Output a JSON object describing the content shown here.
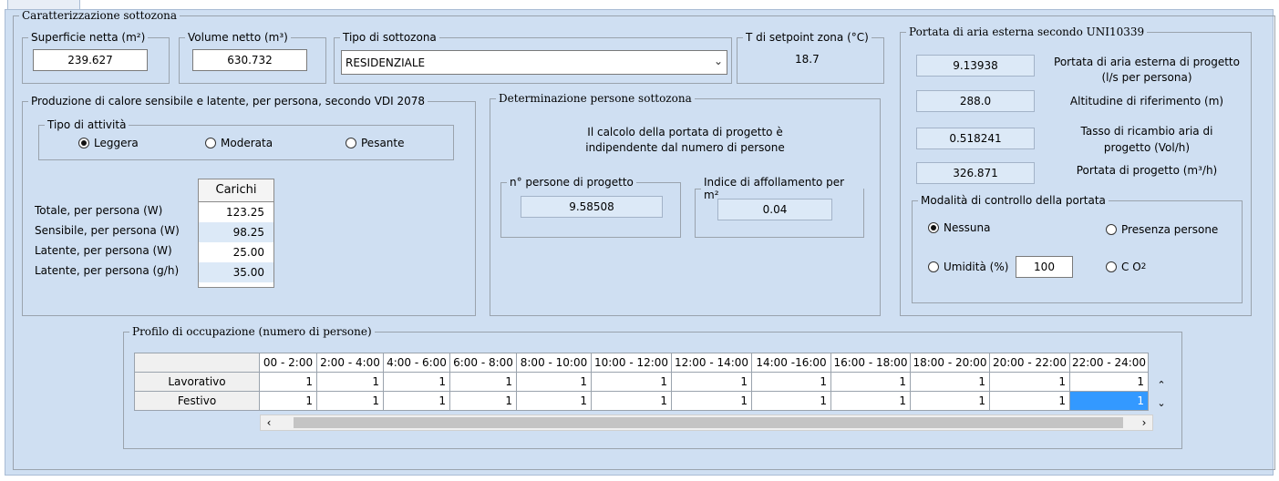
{
  "caratterizzazione": {
    "title": "Caratterizzazione sottozona"
  },
  "superficie": {
    "label": "Superficie netta (m²)",
    "value": "239.627"
  },
  "volume": {
    "label": "Volume netto (m³)",
    "value": "630.732"
  },
  "tipo_sottozona": {
    "label": "Tipo di sottozona",
    "value": "RESIDENZIALE"
  },
  "setpoint": {
    "label": "T di setpoint zona (°C)",
    "value": "18.7"
  },
  "produzione": {
    "title": "Produzione di calore sensibile e latente, per persona,  secondo VDI 2078",
    "attivita_label": "Tipo di attività",
    "attivita": [
      {
        "label": "Leggera",
        "checked": true
      },
      {
        "label": "Moderata",
        "checked": false
      },
      {
        "label": "Pesante",
        "checked": false
      }
    ],
    "carichi_header": "Carichi",
    "rows": [
      {
        "label": "Totale, per persona (W)",
        "value": "123.25"
      },
      {
        "label": "Sensibile, per persona (W)",
        "value": "98.25"
      },
      {
        "label": "Latente, per persona (W)",
        "value": "25.00"
      },
      {
        "label": "Latente, per persona (g/h)",
        "value": "35.00"
      }
    ]
  },
  "determinazione": {
    "title": "Determinazione persone sottozona",
    "note_line1": "Il calcolo della portata di progetto è",
    "note_line2": "indipendente dal numero di persone",
    "persone_label": "n° persone di progetto",
    "persone_value": "9.58508",
    "indice_label": "Indice di affollamento per m²",
    "indice_value": "0.04"
  },
  "portata": {
    "title": "Portata di aria esterna secondo UNI10339",
    "rows": [
      {
        "value": "9.13938",
        "label_line1": "Portata di aria esterna di progetto",
        "label_line2": "(l/s per persona)"
      },
      {
        "value": "288.0",
        "label_line1": "Altitudine di riferimento (m)",
        "label_line2": ""
      },
      {
        "value": "0.518241",
        "label_line1": "Tasso di ricambio aria di",
        "label_line2": "progetto (Vol/h)"
      },
      {
        "value": "326.871",
        "label_line1": "Portata di progetto (m³/h)",
        "label_line2": ""
      }
    ],
    "controllo": {
      "title": "Modalità di controllo della portata",
      "nessuna": "Nessuna",
      "presenza": "Presenza persone",
      "umidita": "Umidità (%)",
      "umidita_value": "100",
      "co2": "C O",
      "co2_sub": "2"
    }
  },
  "profilo": {
    "title": "Profilo di occupazione (numero di persone)",
    "columns": [
      "00 - 2:00",
      "2:00 - 4:00",
      "4:00 - 6:00",
      "6:00 - 8:00",
      "8:00 - 10:00",
      "10:00 - 12:00",
      "12:00 - 14:00",
      "14:00 -16:00",
      "16:00 - 18:00",
      "18:00 - 20:00",
      "20:00 - 22:00",
      "22:00 - 24:00"
    ],
    "rows": [
      {
        "label": "Lavorativo",
        "values": [
          "1",
          "1",
          "1",
          "1",
          "1",
          "1",
          "1",
          "1",
          "1",
          "1",
          "1",
          "1"
        ]
      },
      {
        "label": "Festivo",
        "values": [
          "1",
          "1",
          "1",
          "1",
          "1",
          "1",
          "1",
          "1",
          "1",
          "1",
          "1",
          "1"
        ]
      }
    ]
  },
  "colors": {
    "panel": "#cfdff2",
    "selection": "#3399ff",
    "readonly_field": "#dce9f7"
  }
}
